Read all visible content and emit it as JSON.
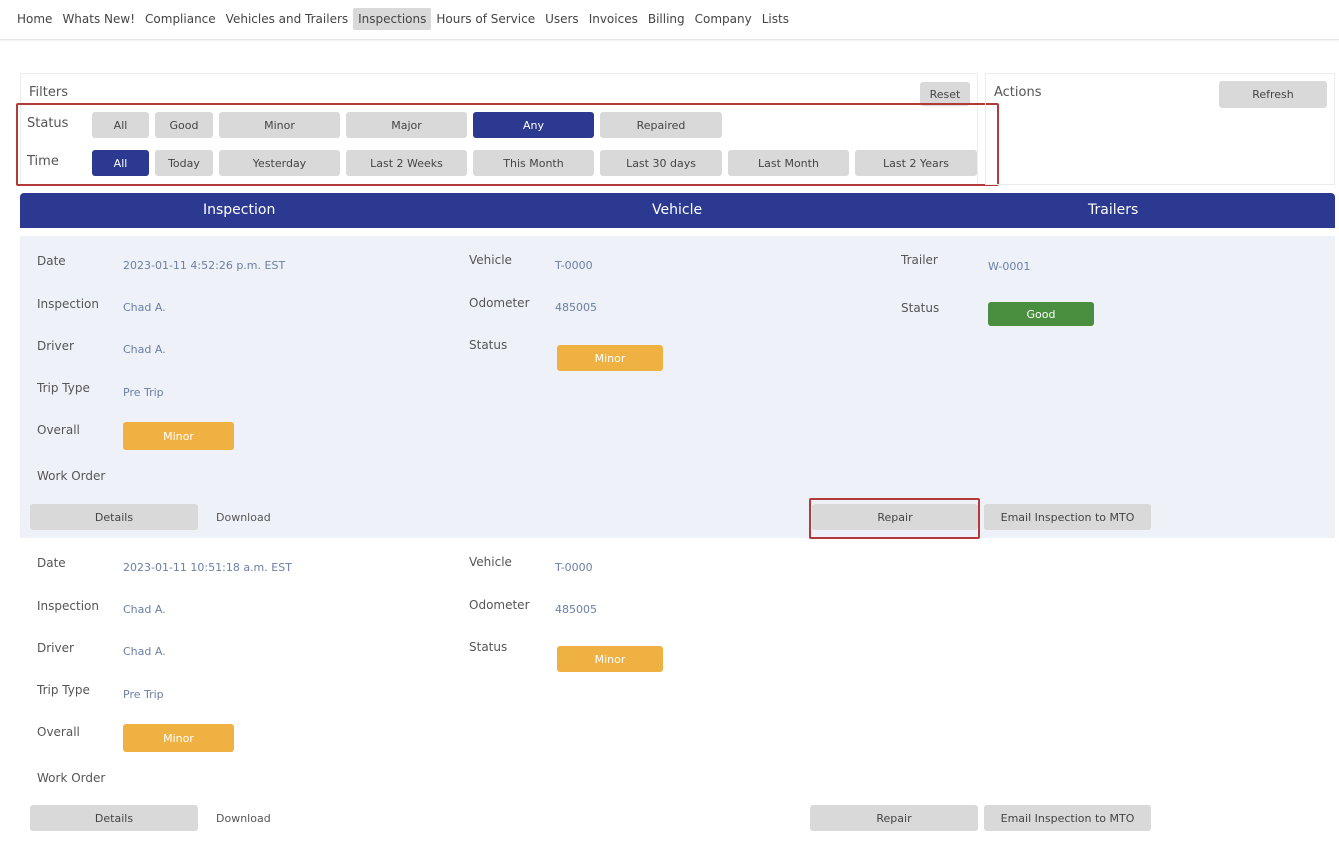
{
  "nav": {
    "items": [
      "Home",
      "Whats New!",
      "Compliance",
      "Vehicles and Trailers",
      "Inspections",
      "Hours of Service",
      "Users",
      "Invoices",
      "Billing",
      "Company",
      "Lists"
    ],
    "active": "Inspections"
  },
  "filters": {
    "title": "Filters",
    "reset_label": "Reset",
    "status_label": "Status",
    "status_options": [
      "All",
      "Good",
      "Minor",
      "Major",
      "Any",
      "Repaired"
    ],
    "status_selected": "Any",
    "time_label": "Time",
    "time_options": [
      "All",
      "Today",
      "Yesterday",
      "Last 2 Weeks",
      "This Month",
      "Last 30 days",
      "Last Month",
      "Last 2 Years"
    ],
    "time_selected": "All"
  },
  "actions": {
    "title": "Actions",
    "refresh_label": "Refresh"
  },
  "table": {
    "headers": [
      "Inspection",
      "Vehicle",
      "Trailers"
    ]
  },
  "labels": {
    "date": "Date",
    "inspection": "Inspection",
    "driver": "Driver",
    "trip_type": "Trip Type",
    "overall": "Overall",
    "work_order": "Work Order",
    "vehicle": "Vehicle",
    "odometer": "Odometer",
    "status": "Status",
    "trailer": "Trailer",
    "details": "Details",
    "download": "Download",
    "repair": "Repair",
    "email": "Email Inspection to MTO"
  },
  "records": [
    {
      "date": "2023-01-11 4:52:26 p.m. EST",
      "inspection": "Chad A.",
      "driver": "Chad A.",
      "trip_type": "Pre Trip",
      "overall": "Minor",
      "vehicle": "T-0000",
      "odometer": "485005",
      "vehicle_status": "Minor",
      "trailer": "W-0001",
      "trailer_status": "Good"
    },
    {
      "date": "2023-01-11 10:51:18 a.m. EST",
      "inspection": "Chad A.",
      "driver": "Chad A.",
      "trip_type": "Pre Trip",
      "overall": "Minor",
      "vehicle": "T-0000",
      "odometer": "485005",
      "vehicle_status": "Minor"
    }
  ],
  "colors": {
    "accent": "#2b3990",
    "minor": "#f0b143",
    "good": "#4a8e3f",
    "highlight": "#b33a3a"
  }
}
